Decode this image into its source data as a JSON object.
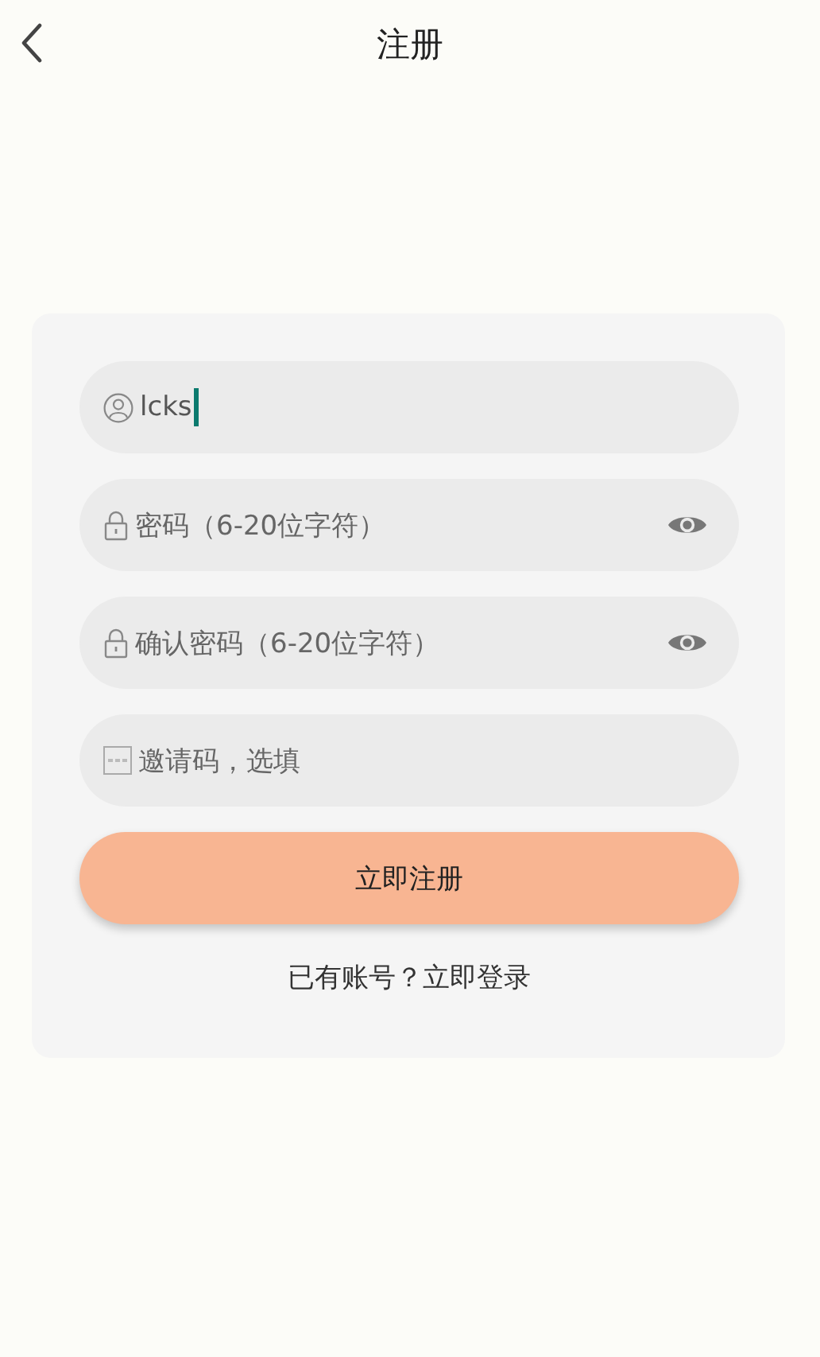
{
  "header": {
    "title": "注册"
  },
  "fields": [
    {
      "kind": "username",
      "value": "lcks",
      "focused": true
    },
    {
      "kind": "password",
      "placeholder": "密码（6-20位字符）",
      "focused": false
    },
    {
      "kind": "password",
      "placeholder": "确认密码（6-20位字符）",
      "focused": false
    },
    {
      "kind": "invite",
      "placeholder": "邀请码，选填",
      "focused": false
    }
  ],
  "submit_button": "立即注册",
  "login_link": "已有账号？立即登录"
}
